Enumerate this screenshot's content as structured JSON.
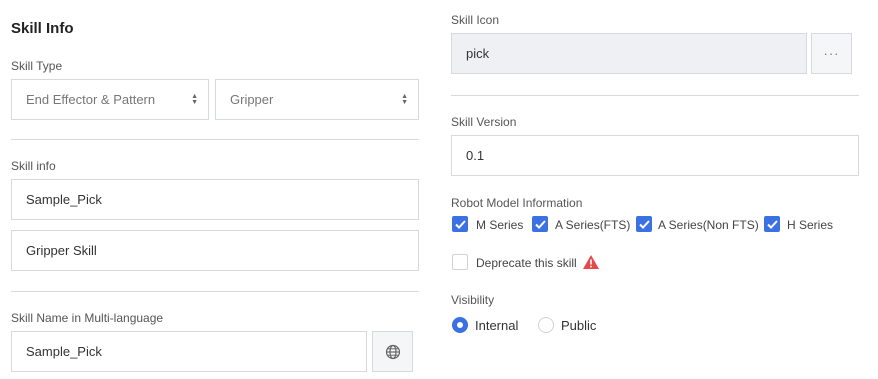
{
  "left": {
    "section_title": "Skill Info",
    "skill_type": {
      "label": "Skill Type",
      "category_value": "End Effector & Pattern",
      "subtype_value": "Gripper"
    },
    "skill_info": {
      "label": "Skill info",
      "name_value": "Sample_Pick",
      "description_value": "Gripper Skill"
    },
    "multilang": {
      "label": "Skill Name in Multi-language",
      "value": "Sample_Pick"
    }
  },
  "right": {
    "skill_icon": {
      "label": "Skill Icon",
      "value": "pick",
      "browse_label": "···"
    },
    "skill_version": {
      "label": "Skill Version",
      "value": "0.1"
    },
    "robot_models": {
      "label": "Robot Model Information",
      "items": [
        {
          "label": "M Series",
          "checked": true
        },
        {
          "label": "A Series(FTS)",
          "checked": true
        },
        {
          "label": "A Series(Non FTS)",
          "checked": true
        },
        {
          "label": "H Series",
          "checked": true
        }
      ]
    },
    "deprecate": {
      "label": "Deprecate this skill",
      "checked": false
    },
    "visibility": {
      "label": "Visibility",
      "options": [
        {
          "label": "Internal",
          "selected": true
        },
        {
          "label": "Public",
          "selected": false
        }
      ]
    }
  },
  "colors": {
    "accent": "#3b71e3",
    "warning": "#e5484d",
    "border": "#d6d9de"
  }
}
